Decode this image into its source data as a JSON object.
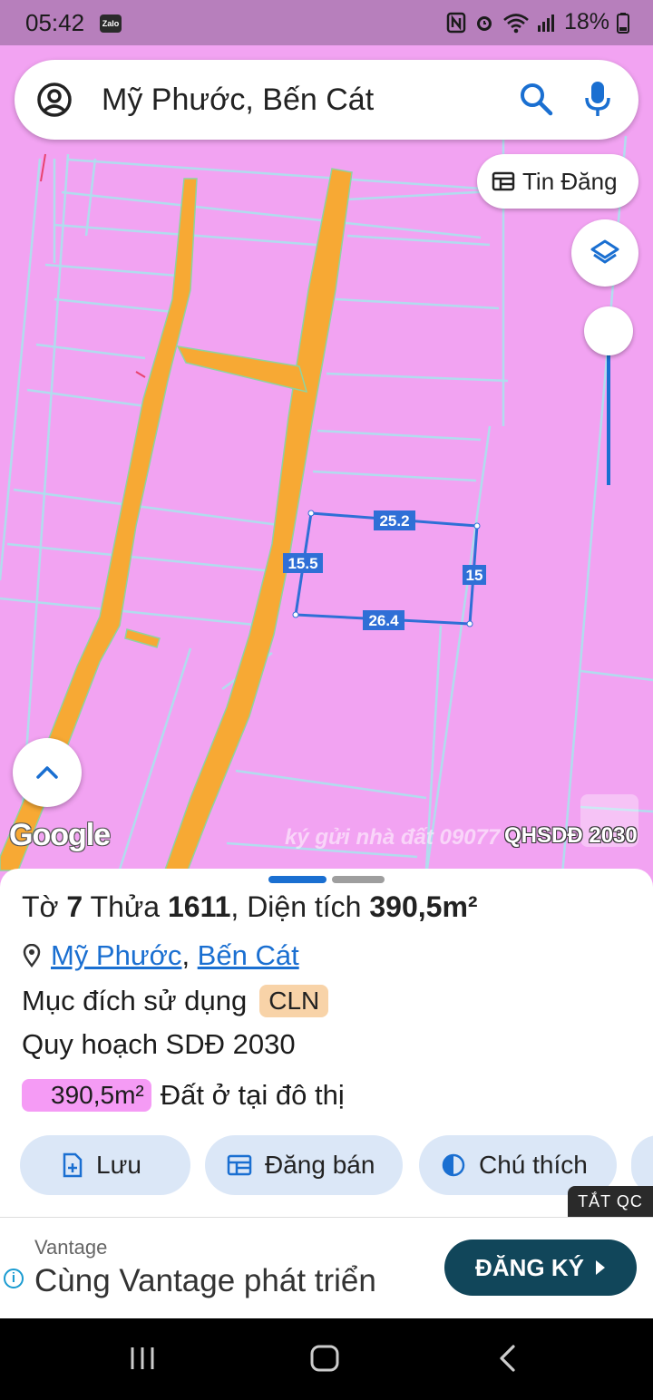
{
  "status_bar": {
    "time": "05:42",
    "app_badge": "Zalo",
    "battery": "18%"
  },
  "search": {
    "query": "Mỹ Phước, Bến Cát"
  },
  "map": {
    "tin_dang_label": "Tin Đăng",
    "dimensions": {
      "top": "25.2",
      "left": "15.5",
      "right": "15",
      "bottom": "26.4"
    },
    "google_label": "Google",
    "watermark": "ký gửi nhà đất 09077",
    "layer_label": "QHSDĐ 2030",
    "colors": {
      "land": "#f2a3f2",
      "road": "#f7a934",
      "parcel_outline": "#2f6fd6"
    }
  },
  "parcel": {
    "to_label": "Tờ",
    "to_value": "7",
    "thua_label": "Thửa",
    "thua_value": "1611",
    "dien_tich_label": ", Diện tích",
    "dien_tich_value": "390,5m²",
    "ward": "Mỹ Phước",
    "district": "Bến Cát",
    "purpose_label": "Mục đích sử dụng",
    "purpose_code": "CLN",
    "plan_label": "Quy hoạch SDĐ 2030",
    "zone_area": "390,5m²",
    "zone_type": "Đất ở tại đô thị"
  },
  "actions": [
    {
      "label": "Lưu",
      "icon": "add-file-icon"
    },
    {
      "label": "Đăng bán",
      "icon": "listing-icon"
    },
    {
      "label": "Chú thích",
      "icon": "contrast-icon"
    }
  ],
  "ad": {
    "close_label": "TẮT QC",
    "brand": "Vantage",
    "headline": "Cùng Vantage phát triển",
    "cta": "ĐĂNG KÝ"
  }
}
